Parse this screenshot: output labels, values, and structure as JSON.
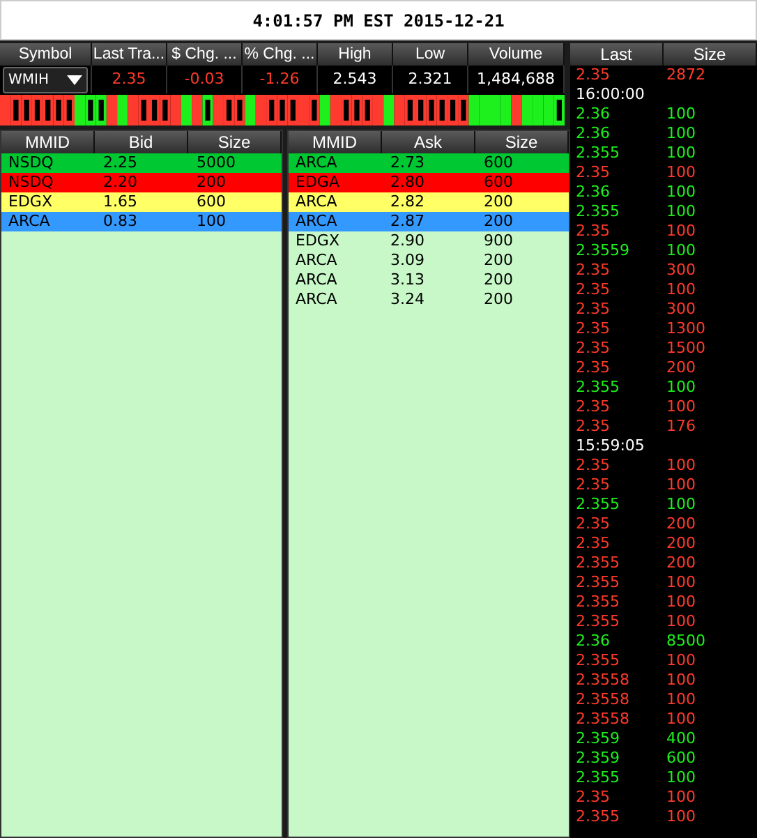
{
  "clock": "4:01:57 PM EST 2015-12-21",
  "quote": {
    "columns": [
      "Symbol",
      "Last Tra...",
      "$ Chg. ...",
      "% Chg. ...",
      "High",
      "Low",
      "Volume"
    ],
    "symbol": "WMIH",
    "values": [
      {
        "text": "2.35",
        "down": true
      },
      {
        "text": "-0.03",
        "down": true
      },
      {
        "text": "-1.26",
        "down": true
      },
      {
        "text": "2.543",
        "down": false
      },
      {
        "text": "2.321",
        "down": false
      },
      {
        "text": "1,484,688",
        "down": false
      }
    ]
  },
  "bid_book": {
    "columns": [
      "MMID",
      "Bid",
      "Size"
    ],
    "rows": [
      {
        "mmid": "NSDQ",
        "price": "2.25",
        "size": "5000",
        "color": "#00c832"
      },
      {
        "mmid": "NSDQ",
        "price": "2.20",
        "size": "200",
        "color": "#ff0000"
      },
      {
        "mmid": "EDGX",
        "price": "1.65",
        "size": "600",
        "color": "#ffff66"
      },
      {
        "mmid": "ARCA",
        "price": "0.83",
        "size": "100",
        "color": "#3399ff"
      }
    ]
  },
  "ask_book": {
    "columns": [
      "MMID",
      "Ask",
      "Size"
    ],
    "rows": [
      {
        "mmid": "ARCA",
        "price": "2.73",
        "size": "600",
        "color": "#00c832"
      },
      {
        "mmid": "EDGA",
        "price": "2.80",
        "size": "600",
        "color": "#ff0000"
      },
      {
        "mmid": "ARCA",
        "price": "2.82",
        "size": "200",
        "color": "#ffff66"
      },
      {
        "mmid": "ARCA",
        "price": "2.87",
        "size": "200",
        "color": "#3399ff"
      },
      {
        "mmid": "EDGX",
        "price": "2.90",
        "size": "900",
        "color": "#c8f8c8"
      },
      {
        "mmid": "ARCA",
        "price": "3.09",
        "size": "200",
        "color": "#c8f8c8"
      },
      {
        "mmid": "ARCA",
        "price": "3.13",
        "size": "200",
        "color": "#c8f8c8"
      },
      {
        "mmid": "ARCA",
        "price": "3.24",
        "size": "200",
        "color": "#c8f8c8"
      }
    ]
  },
  "time_and_sales": {
    "columns": [
      "Last",
      "Size"
    ],
    "rows": [
      {
        "kind": "trade",
        "price": "2.35",
        "size": "2872",
        "up": false
      },
      {
        "kind": "time",
        "time": "16:00:00"
      },
      {
        "kind": "trade",
        "price": "2.36",
        "size": "100",
        "up": true
      },
      {
        "kind": "trade",
        "price": "2.36",
        "size": "100",
        "up": true
      },
      {
        "kind": "trade",
        "price": "2.355",
        "size": "100",
        "up": true
      },
      {
        "kind": "trade",
        "price": "2.35",
        "size": "100",
        "up": false
      },
      {
        "kind": "trade",
        "price": "2.36",
        "size": "100",
        "up": true
      },
      {
        "kind": "trade",
        "price": "2.355",
        "size": "100",
        "up": true
      },
      {
        "kind": "trade",
        "price": "2.35",
        "size": "100",
        "up": false
      },
      {
        "kind": "trade",
        "price": "2.3559",
        "size": "100",
        "up": true
      },
      {
        "kind": "trade",
        "price": "2.35",
        "size": "300",
        "up": false
      },
      {
        "kind": "trade",
        "price": "2.35",
        "size": "100",
        "up": false
      },
      {
        "kind": "trade",
        "price": "2.35",
        "size": "300",
        "up": false
      },
      {
        "kind": "trade",
        "price": "2.35",
        "size": "1300",
        "up": false
      },
      {
        "kind": "trade",
        "price": "2.35",
        "size": "1500",
        "up": false
      },
      {
        "kind": "trade",
        "price": "2.35",
        "size": "200",
        "up": false
      },
      {
        "kind": "trade",
        "price": "2.355",
        "size": "100",
        "up": true
      },
      {
        "kind": "trade",
        "price": "2.35",
        "size": "100",
        "up": false
      },
      {
        "kind": "trade",
        "price": "2.35",
        "size": "176",
        "up": false
      },
      {
        "kind": "time",
        "time": "15:59:05"
      },
      {
        "kind": "trade",
        "price": "2.35",
        "size": "100",
        "up": false
      },
      {
        "kind": "trade",
        "price": "2.35",
        "size": "100",
        "up": false
      },
      {
        "kind": "trade",
        "price": "2.355",
        "size": "100",
        "up": true
      },
      {
        "kind": "trade",
        "price": "2.35",
        "size": "200",
        "up": false
      },
      {
        "kind": "trade",
        "price": "2.35",
        "size": "200",
        "up": false
      },
      {
        "kind": "trade",
        "price": "2.355",
        "size": "200",
        "up": false
      },
      {
        "kind": "trade",
        "price": "2.355",
        "size": "100",
        "up": false
      },
      {
        "kind": "trade",
        "price": "2.355",
        "size": "100",
        "up": false
      },
      {
        "kind": "trade",
        "price": "2.355",
        "size": "100",
        "up": false
      },
      {
        "kind": "trade",
        "price": "2.36",
        "size": "8500",
        "up": true
      },
      {
        "kind": "trade",
        "price": "2.355",
        "size": "100",
        "up": false
      },
      {
        "kind": "trade",
        "price": "2.3558",
        "size": "100",
        "up": false
      },
      {
        "kind": "trade",
        "price": "2.3558",
        "size": "100",
        "up": false
      },
      {
        "kind": "trade",
        "price": "2.3558",
        "size": "100",
        "up": false
      },
      {
        "kind": "trade",
        "price": "2.359",
        "size": "400",
        "up": true
      },
      {
        "kind": "trade",
        "price": "2.359",
        "size": "600",
        "up": true
      },
      {
        "kind": "trade",
        "price": "2.355",
        "size": "100",
        "up": true
      },
      {
        "kind": "trade",
        "price": "2.35",
        "size": "100",
        "up": false
      },
      {
        "kind": "trade",
        "price": "2.355",
        "size": "100",
        "up": false
      }
    ]
  }
}
